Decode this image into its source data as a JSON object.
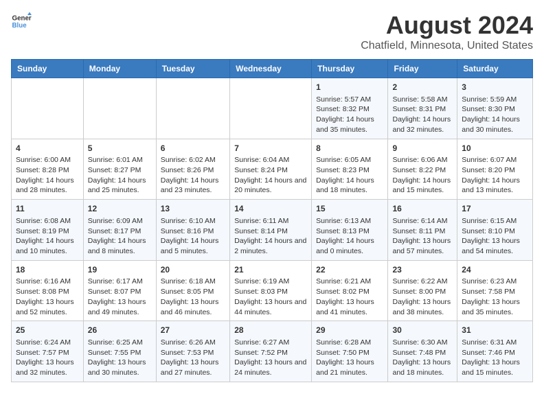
{
  "logo": {
    "text_general": "General",
    "text_blue": "Blue"
  },
  "title": "August 2024",
  "subtitle": "Chatfield, Minnesota, United States",
  "days_of_week": [
    "Sunday",
    "Monday",
    "Tuesday",
    "Wednesday",
    "Thursday",
    "Friday",
    "Saturday"
  ],
  "weeks": [
    [
      {
        "day": "",
        "content": ""
      },
      {
        "day": "",
        "content": ""
      },
      {
        "day": "",
        "content": ""
      },
      {
        "day": "",
        "content": ""
      },
      {
        "day": "1",
        "content": "Sunrise: 5:57 AM\nSunset: 8:32 PM\nDaylight: 14 hours and 35 minutes."
      },
      {
        "day": "2",
        "content": "Sunrise: 5:58 AM\nSunset: 8:31 PM\nDaylight: 14 hours and 32 minutes."
      },
      {
        "day": "3",
        "content": "Sunrise: 5:59 AM\nSunset: 8:30 PM\nDaylight: 14 hours and 30 minutes."
      }
    ],
    [
      {
        "day": "4",
        "content": "Sunrise: 6:00 AM\nSunset: 8:28 PM\nDaylight: 14 hours and 28 minutes."
      },
      {
        "day": "5",
        "content": "Sunrise: 6:01 AM\nSunset: 8:27 PM\nDaylight: 14 hours and 25 minutes."
      },
      {
        "day": "6",
        "content": "Sunrise: 6:02 AM\nSunset: 8:26 PM\nDaylight: 14 hours and 23 minutes."
      },
      {
        "day": "7",
        "content": "Sunrise: 6:04 AM\nSunset: 8:24 PM\nDaylight: 14 hours and 20 minutes."
      },
      {
        "day": "8",
        "content": "Sunrise: 6:05 AM\nSunset: 8:23 PM\nDaylight: 14 hours and 18 minutes."
      },
      {
        "day": "9",
        "content": "Sunrise: 6:06 AM\nSunset: 8:22 PM\nDaylight: 14 hours and 15 minutes."
      },
      {
        "day": "10",
        "content": "Sunrise: 6:07 AM\nSunset: 8:20 PM\nDaylight: 14 hours and 13 minutes."
      }
    ],
    [
      {
        "day": "11",
        "content": "Sunrise: 6:08 AM\nSunset: 8:19 PM\nDaylight: 14 hours and 10 minutes."
      },
      {
        "day": "12",
        "content": "Sunrise: 6:09 AM\nSunset: 8:17 PM\nDaylight: 14 hours and 8 minutes."
      },
      {
        "day": "13",
        "content": "Sunrise: 6:10 AM\nSunset: 8:16 PM\nDaylight: 14 hours and 5 minutes."
      },
      {
        "day": "14",
        "content": "Sunrise: 6:11 AM\nSunset: 8:14 PM\nDaylight: 14 hours and 2 minutes."
      },
      {
        "day": "15",
        "content": "Sunrise: 6:13 AM\nSunset: 8:13 PM\nDaylight: 14 hours and 0 minutes."
      },
      {
        "day": "16",
        "content": "Sunrise: 6:14 AM\nSunset: 8:11 PM\nDaylight: 13 hours and 57 minutes."
      },
      {
        "day": "17",
        "content": "Sunrise: 6:15 AM\nSunset: 8:10 PM\nDaylight: 13 hours and 54 minutes."
      }
    ],
    [
      {
        "day": "18",
        "content": "Sunrise: 6:16 AM\nSunset: 8:08 PM\nDaylight: 13 hours and 52 minutes."
      },
      {
        "day": "19",
        "content": "Sunrise: 6:17 AM\nSunset: 8:07 PM\nDaylight: 13 hours and 49 minutes."
      },
      {
        "day": "20",
        "content": "Sunrise: 6:18 AM\nSunset: 8:05 PM\nDaylight: 13 hours and 46 minutes."
      },
      {
        "day": "21",
        "content": "Sunrise: 6:19 AM\nSunset: 8:03 PM\nDaylight: 13 hours and 44 minutes."
      },
      {
        "day": "22",
        "content": "Sunrise: 6:21 AM\nSunset: 8:02 PM\nDaylight: 13 hours and 41 minutes."
      },
      {
        "day": "23",
        "content": "Sunrise: 6:22 AM\nSunset: 8:00 PM\nDaylight: 13 hours and 38 minutes."
      },
      {
        "day": "24",
        "content": "Sunrise: 6:23 AM\nSunset: 7:58 PM\nDaylight: 13 hours and 35 minutes."
      }
    ],
    [
      {
        "day": "25",
        "content": "Sunrise: 6:24 AM\nSunset: 7:57 PM\nDaylight: 13 hours and 32 minutes."
      },
      {
        "day": "26",
        "content": "Sunrise: 6:25 AM\nSunset: 7:55 PM\nDaylight: 13 hours and 30 minutes."
      },
      {
        "day": "27",
        "content": "Sunrise: 6:26 AM\nSunset: 7:53 PM\nDaylight: 13 hours and 27 minutes."
      },
      {
        "day": "28",
        "content": "Sunrise: 6:27 AM\nSunset: 7:52 PM\nDaylight: 13 hours and 24 minutes."
      },
      {
        "day": "29",
        "content": "Sunrise: 6:28 AM\nSunset: 7:50 PM\nDaylight: 13 hours and 21 minutes."
      },
      {
        "day": "30",
        "content": "Sunrise: 6:30 AM\nSunset: 7:48 PM\nDaylight: 13 hours and 18 minutes."
      },
      {
        "day": "31",
        "content": "Sunrise: 6:31 AM\nSunset: 7:46 PM\nDaylight: 13 hours and 15 minutes."
      }
    ]
  ]
}
